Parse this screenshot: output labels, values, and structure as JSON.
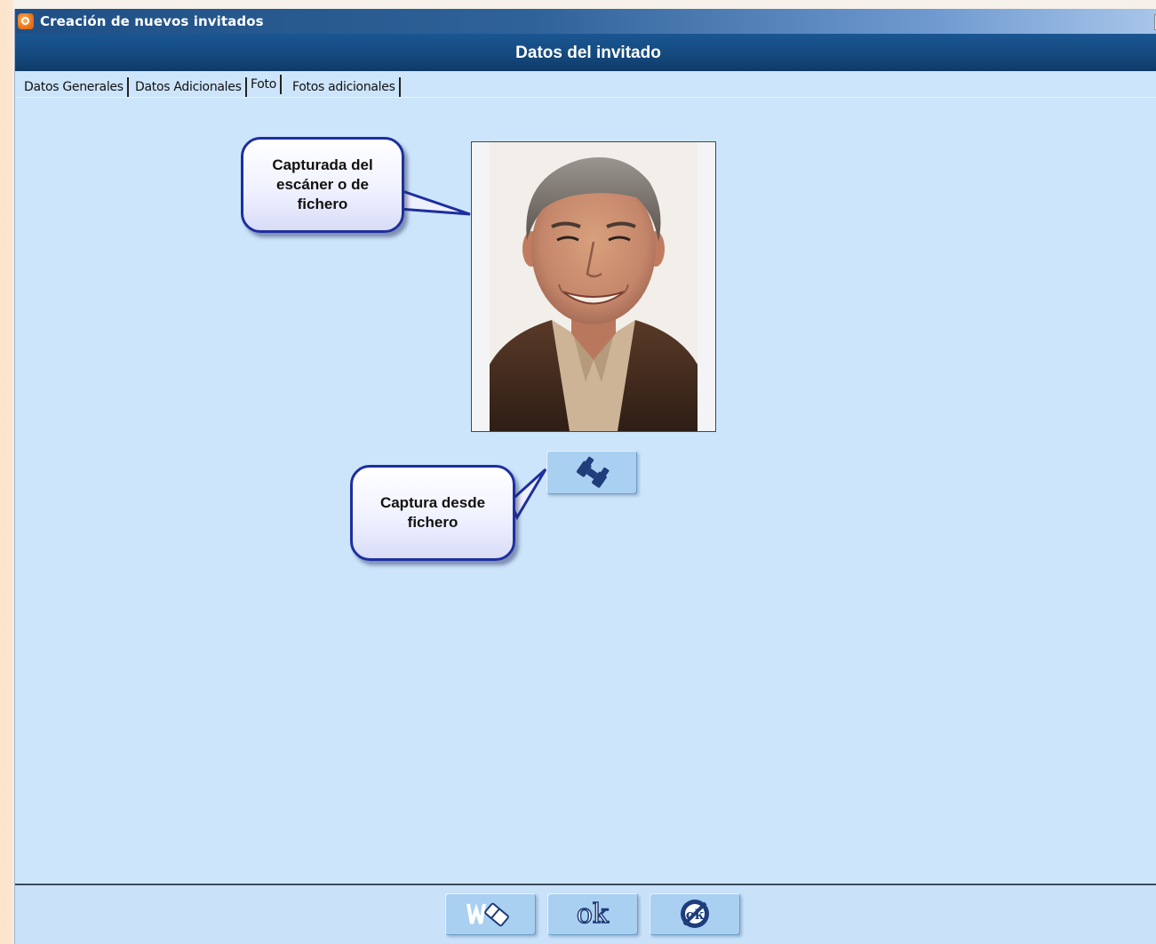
{
  "window": {
    "title": "Creación de nuevos invitados",
    "header": "Datos del invitado"
  },
  "tabs": [
    {
      "label": "Datos Generales",
      "active": false
    },
    {
      "label": "Datos Adicionales",
      "active": false
    },
    {
      "label": "Foto",
      "active": true
    },
    {
      "label": "Fotos adicionales",
      "active": false
    }
  ],
  "callouts": {
    "photo": "Capturada del\nescáner o de\nfichero",
    "file_button": "Captura desde\nfichero"
  },
  "icons": {
    "capture_button": "binoculars-icon",
    "clear_button": "eraser-icon",
    "ok_button": "ok-icon",
    "cancel_button": "cancel-ok-icon"
  },
  "buttons": {
    "ok_label": "ok",
    "cancel_label": "ok"
  },
  "colors": {
    "panel_bg": "#cde5fb",
    "header_bg": "#154a7f",
    "callout_border": "#1d2f9e",
    "button_bg": "#a9d0f1"
  }
}
